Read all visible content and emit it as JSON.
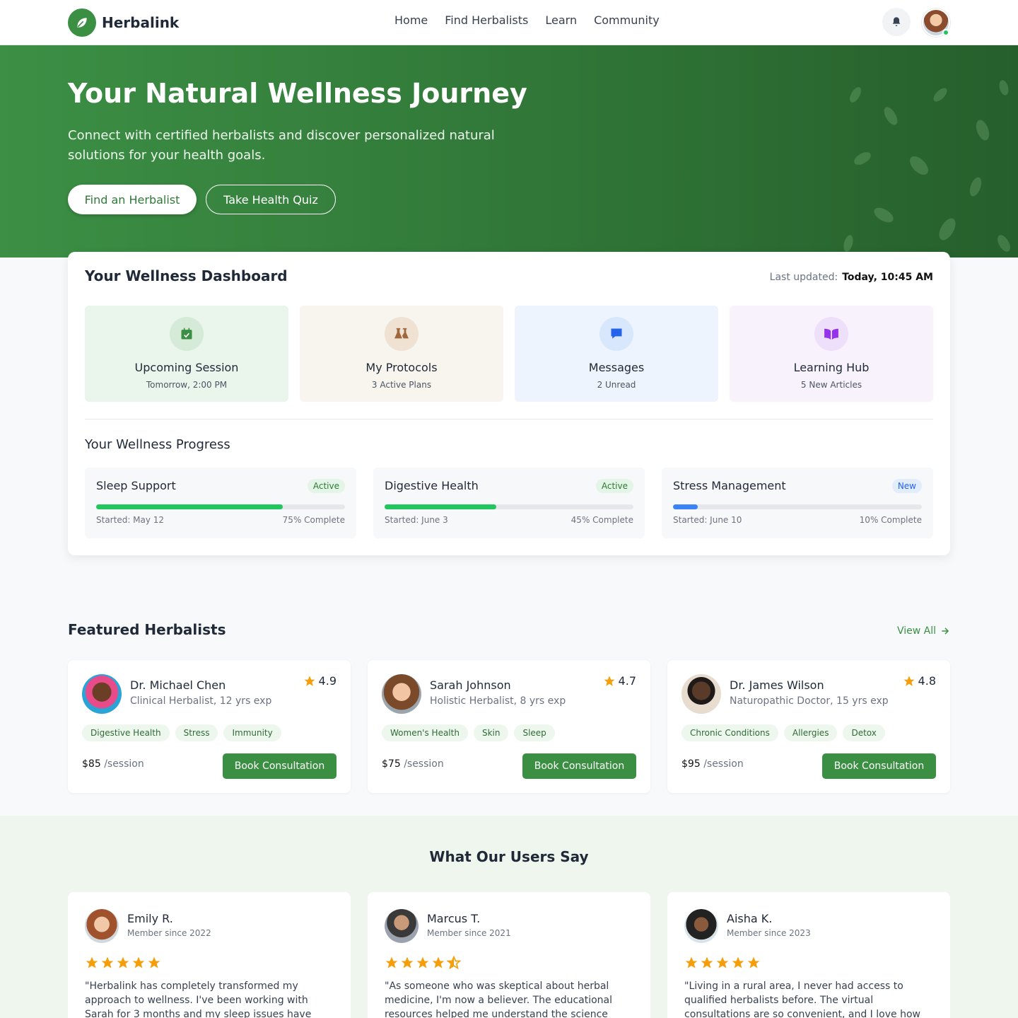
{
  "brand": {
    "name": "Herbalink",
    "accent": "#3b8f43"
  },
  "nav": {
    "links": [
      "Home",
      "Find Herbalists",
      "Learn",
      "Community"
    ]
  },
  "hero": {
    "title": "Your Natural Wellness Journey",
    "subtitle": "Connect with certified herbalists and discover personalized natural solutions for your health goals.",
    "primary_cta": "Find an Herbalist",
    "secondary_cta": "Take Health Quiz"
  },
  "dashboard": {
    "title": "Your Wellness Dashboard",
    "updated_label": "Last updated:",
    "updated_value": "Today, 10:45 AM",
    "tiles": [
      {
        "title": "Upcoming Session",
        "sub": "Tomorrow, 2:00 PM",
        "icon": "calendar-check-icon"
      },
      {
        "title": "My Protocols",
        "sub": "3 Active Plans",
        "icon": "flask-icon"
      },
      {
        "title": "Messages",
        "sub": "2 Unread",
        "icon": "chat-icon"
      },
      {
        "title": "Learning Hub",
        "sub": "5 New Articles",
        "icon": "book-icon"
      }
    ],
    "progress_title": "Your Wellness Progress",
    "progress": [
      {
        "name": "Sleep Support",
        "badge": "Active",
        "started": "Started: May 12",
        "complete": "75% Complete",
        "pct": 0.75
      },
      {
        "name": "Digestive Health",
        "badge": "Active",
        "started": "Started: June 3",
        "complete": "45% Complete",
        "pct": 0.45
      },
      {
        "name": "Stress Management",
        "badge": "New",
        "started": "Started: June 10",
        "complete": "10% Complete",
        "pct": 0.1
      }
    ]
  },
  "featured": {
    "title": "Featured Herbalists",
    "view_all": "View All",
    "price_suffix": "/session",
    "book_label": "Book Consultation",
    "items": [
      {
        "name": "Dr. Michael Chen",
        "role": "Clinical Herbalist, 12 yrs exp",
        "rating": "4.9",
        "tags": [
          "Digestive Health",
          "Stress",
          "Immunity"
        ],
        "price": "$85"
      },
      {
        "name": "Sarah Johnson",
        "role": "Holistic Herbalist, 8 yrs exp",
        "rating": "4.7",
        "tags": [
          "Women's Health",
          "Skin",
          "Sleep"
        ],
        "price": "$75"
      },
      {
        "name": "Dr. James Wilson",
        "role": "Naturopathic Doctor, 15 yrs exp",
        "rating": "4.8",
        "tags": [
          "Chronic Conditions",
          "Allergies",
          "Detox"
        ],
        "price": "$95"
      }
    ]
  },
  "testimonials": {
    "title": "What Our Users Say",
    "items": [
      {
        "name": "Emily R.",
        "since": "Member since 2022",
        "stars": 5,
        "quote": "\"Herbalink has completely transformed my approach to wellness. I've been working with Sarah for 3 months and my sleep issues have"
      },
      {
        "name": "Marcus T.",
        "since": "Member since 2021",
        "stars": 4.5,
        "quote": "\"As someone who was skeptical about herbal medicine, I'm now a believer. The educational resources helped me understand the science"
      },
      {
        "name": "Aisha K.",
        "since": "Member since 2023",
        "stars": 5,
        "quote": "\"Living in a rural area, I never had access to qualified herbalists before. The virtual consultations are so convenient, and I love how"
      }
    ]
  }
}
